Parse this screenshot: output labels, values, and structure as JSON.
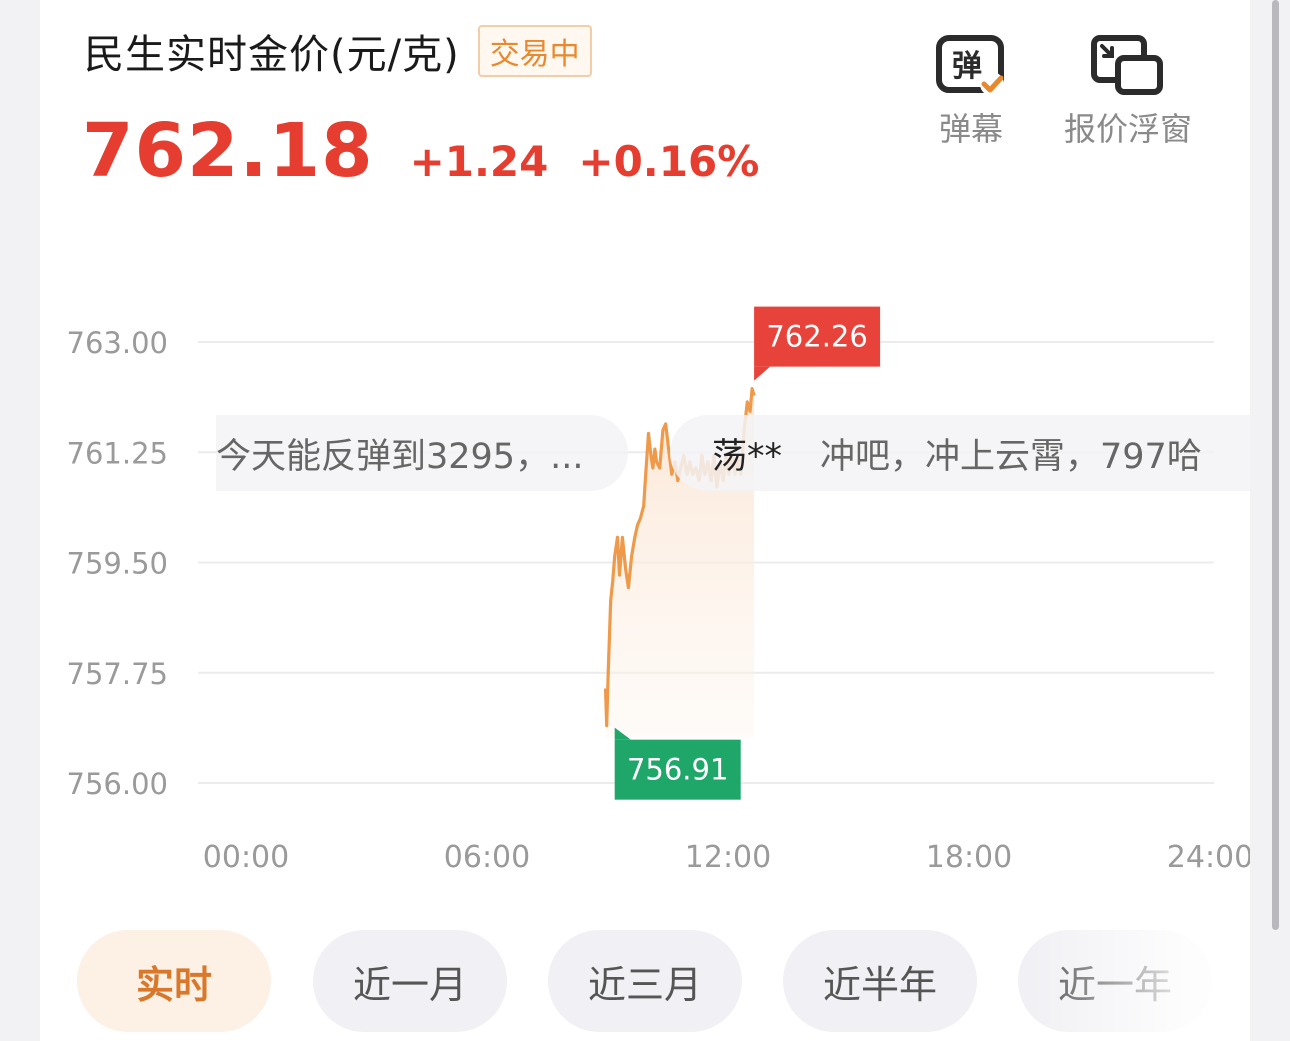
{
  "header": {
    "title": "民生实时金价(元/克)",
    "status": "交易中",
    "price": "762.18",
    "change": "+1.24",
    "change_pct": "+0.16%"
  },
  "tools": {
    "danmu_icon_text": "弹",
    "danmu_label": "弹幕",
    "float_label": "报价浮窗"
  },
  "colors": {
    "up_red": "#e53e30",
    "down_green": "#1fa76a",
    "line_orange": "#ee9a4a",
    "accent_orange": "#e9892e"
  },
  "chart_data": {
    "type": "line",
    "x_ticks": [
      "00:00",
      "06:00",
      "12:00",
      "18:00",
      "24:00"
    ],
    "y_ticks": [
      "763.00",
      "761.25",
      "759.50",
      "757.75",
      "756.00"
    ],
    "ylim": [
      756.0,
      763.0
    ],
    "xlim_hours": [
      0,
      24
    ],
    "max_label": "762.26",
    "min_label": "756.91",
    "series": [
      {
        "points": [
          [
            8.95,
            757.5
          ],
          [
            8.98,
            756.91
          ],
          [
            9.02,
            757.8
          ],
          [
            9.08,
            758.9
          ],
          [
            9.13,
            759.2
          ],
          [
            9.18,
            759.6
          ],
          [
            9.25,
            759.9
          ],
          [
            9.3,
            759.3
          ],
          [
            9.37,
            759.9
          ],
          [
            9.45,
            759.4
          ],
          [
            9.52,
            759.1
          ],
          [
            9.6,
            759.6
          ],
          [
            9.68,
            759.9
          ],
          [
            9.75,
            760.1
          ],
          [
            9.82,
            760.2
          ],
          [
            9.9,
            760.4
          ],
          [
            9.95,
            760.9
          ],
          [
            10.02,
            761.55
          ],
          [
            10.08,
            761.2
          ],
          [
            10.13,
            761.0
          ],
          [
            10.18,
            761.3
          ],
          [
            10.22,
            761.1
          ],
          [
            10.3,
            761.0
          ],
          [
            10.38,
            761.6
          ],
          [
            10.45,
            761.7
          ],
          [
            10.52,
            761.3
          ],
          [
            10.6,
            760.9
          ],
          [
            10.68,
            761.1
          ],
          [
            10.75,
            760.8
          ],
          [
            10.82,
            761.0
          ],
          [
            10.9,
            761.2
          ],
          [
            10.98,
            760.9
          ],
          [
            11.05,
            761.1
          ],
          [
            11.12,
            760.9
          ],
          [
            11.2,
            761.0
          ],
          [
            11.28,
            760.8
          ],
          [
            11.35,
            761.2
          ],
          [
            11.42,
            760.9
          ],
          [
            11.5,
            761.1
          ],
          [
            11.58,
            760.8
          ],
          [
            11.65,
            761.2
          ],
          [
            11.72,
            760.7
          ],
          [
            11.8,
            761.1
          ],
          [
            11.88,
            760.8
          ],
          [
            11.95,
            761.2
          ],
          [
            12.02,
            760.9
          ],
          [
            12.1,
            761.3
          ],
          [
            12.18,
            760.9
          ],
          [
            12.25,
            761.2
          ],
          [
            12.32,
            760.9
          ],
          [
            12.4,
            761.6
          ],
          [
            12.48,
            762.05
          ],
          [
            12.55,
            761.9
          ],
          [
            12.6,
            762.26
          ],
          [
            12.65,
            762.15
          ]
        ]
      }
    ]
  },
  "danmaku": [
    {
      "text": "今天能反弹到3295，..."
    },
    {
      "user": "荡**",
      "text": "冲吧，冲上云霄，797哈"
    }
  ],
  "ranges": [
    "实时",
    "近一月",
    "近三月",
    "近半年",
    "近一年"
  ]
}
